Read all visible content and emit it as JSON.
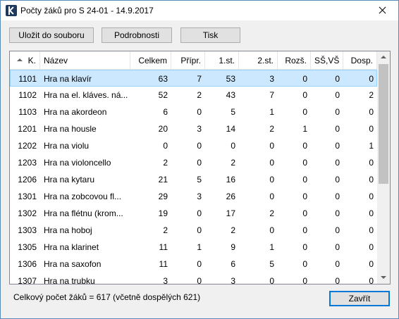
{
  "window": {
    "title": "Počty žáků pro S 24-01 - 14.9.2017",
    "app_icon": "k-logo-icon",
    "close_icon": "close-icon"
  },
  "toolbar": {
    "save_label": "Uložit do souboru",
    "details_label": "Podrobnosti",
    "print_label": "Tisk"
  },
  "table": {
    "columns": [
      "K.",
      "Název",
      "Celkem",
      "Přípr.",
      "1.st.",
      "2.st.",
      "Rozš.",
      "SŠ,VŠ",
      "Dosp."
    ],
    "sorted_column": "K.",
    "sort_direction": "ascending",
    "selected_row": 0,
    "rows": [
      [
        "1101",
        "Hra na klavír",
        "63",
        "7",
        "53",
        "3",
        "0",
        "0",
        "0"
      ],
      [
        "1102",
        "Hra na el. kláves. ná...",
        "52",
        "2",
        "43",
        "7",
        "0",
        "0",
        "2"
      ],
      [
        "1103",
        "Hra na akordeon",
        "6",
        "0",
        "5",
        "1",
        "0",
        "0",
        "0"
      ],
      [
        "1201",
        "Hra na housle",
        "20",
        "3",
        "14",
        "2",
        "1",
        "0",
        "0"
      ],
      [
        "1202",
        "Hra na violu",
        "0",
        "0",
        "0",
        "0",
        "0",
        "0",
        "1"
      ],
      [
        "1203",
        "Hra na violoncello",
        "2",
        "0",
        "2",
        "0",
        "0",
        "0",
        "0"
      ],
      [
        "1206",
        "Hra na kytaru",
        "21",
        "5",
        "16",
        "0",
        "0",
        "0",
        "0"
      ],
      [
        "1301",
        "Hra na zobcovou fl...",
        "29",
        "3",
        "26",
        "0",
        "0",
        "0",
        "0"
      ],
      [
        "1302",
        "Hra na flétnu (krom...",
        "19",
        "0",
        "17",
        "2",
        "0",
        "0",
        "0"
      ],
      [
        "1303",
        "Hra na hoboj",
        "2",
        "0",
        "2",
        "0",
        "0",
        "0",
        "0"
      ],
      [
        "1305",
        "Hra na klarinet",
        "11",
        "1",
        "9",
        "1",
        "0",
        "0",
        "0"
      ],
      [
        "1306",
        "Hra na saxofon",
        "11",
        "0",
        "6",
        "5",
        "0",
        "0",
        "0"
      ],
      [
        "1307",
        "Hra na trubku",
        "3",
        "0",
        "3",
        "0",
        "0",
        "0",
        "0"
      ]
    ]
  },
  "status": {
    "text": "Celkový počet žáků = 617 (včetně dospělých 621)"
  },
  "footer": {
    "close_label": "Zavřít"
  }
}
